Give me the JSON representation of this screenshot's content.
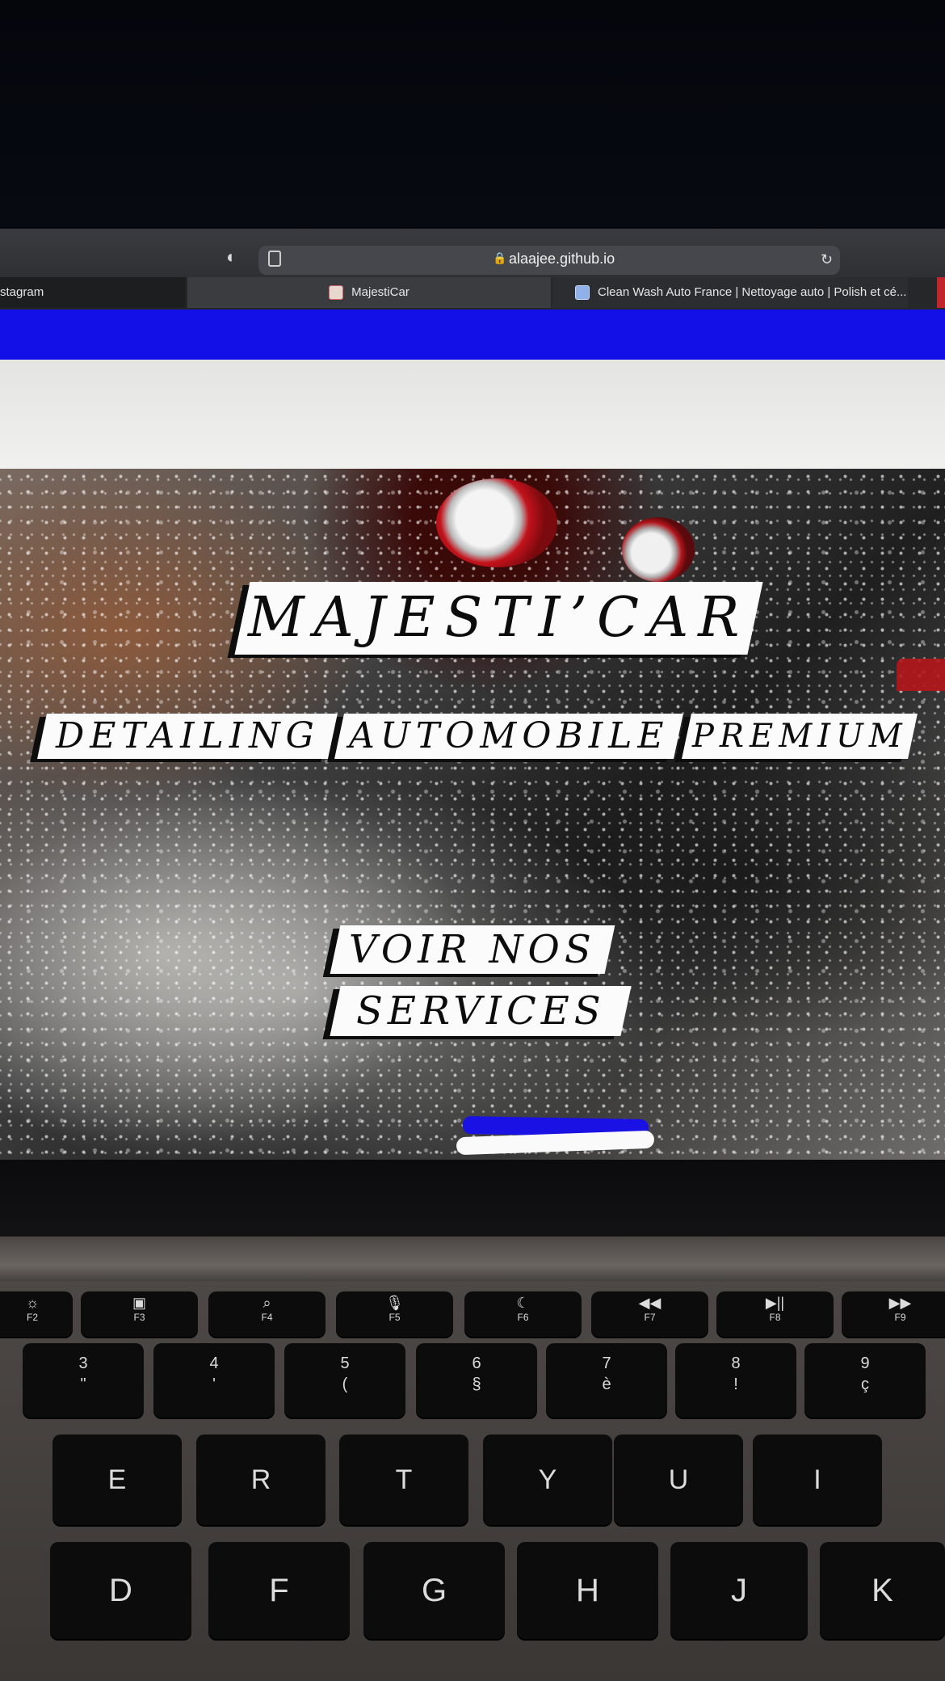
{
  "browser": {
    "url": "alaajee.github.io",
    "tabs": [
      {
        "label": "stagram"
      },
      {
        "label": "MajestiCar"
      },
      {
        "label": "Clean Wash Auto France | Nettoyage auto | Polish et cé..."
      }
    ]
  },
  "hero": {
    "title": "MAJESTI’CAR",
    "subtitle_words": [
      "DETAILING",
      "AUTOMOBILE",
      "PREMIUM"
    ],
    "cta_line1": "VOIR NOS",
    "cta_line2": "SERVICES"
  },
  "colors": {
    "top_bar": "#1210e6",
    "label_bg": "#fbfbfb",
    "label_text": "#0c0c0c"
  },
  "keyboard": {
    "function_row": [
      {
        "glyph": "☼",
        "label": "F2"
      },
      {
        "glyph": "▣",
        "label": "F3"
      },
      {
        "glyph": "⌕",
        "label": "F4"
      },
      {
        "glyph": "🎙",
        "label": "F5"
      },
      {
        "glyph": "☾",
        "label": "F6"
      },
      {
        "glyph": "◀◀",
        "label": "F7"
      },
      {
        "glyph": "▶||",
        "label": "F8"
      },
      {
        "glyph": "▶▶",
        "label": "F9"
      }
    ],
    "number_row": [
      {
        "top": "3",
        "bottom": "\""
      },
      {
        "top": "4",
        "bottom": "'"
      },
      {
        "top": "5",
        "bottom": "("
      },
      {
        "top": "6",
        "bottom": "§"
      },
      {
        "top": "7",
        "bottom": "è"
      },
      {
        "top": "8",
        "bottom": "!"
      },
      {
        "top": "9",
        "bottom": "ç"
      }
    ],
    "letter_row": [
      "E",
      "R",
      "T",
      "Y",
      "U",
      "I"
    ],
    "home_row": [
      "D",
      "F",
      "G",
      "H",
      "J",
      "K"
    ]
  }
}
